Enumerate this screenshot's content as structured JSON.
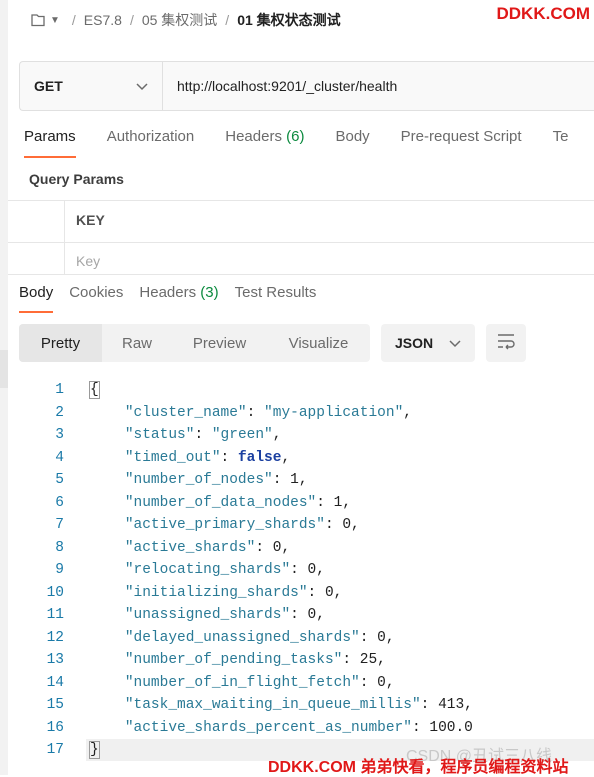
{
  "breadcrumb": {
    "items": [
      "ES7.8",
      "05 集权测试"
    ],
    "current": "01 集权状态测试",
    "separator": "/"
  },
  "watermark_top": "DDKK.COM",
  "request": {
    "method": "GET",
    "url": "http://localhost:9201/_cluster/health"
  },
  "request_tabs": [
    {
      "label": "Params",
      "count": ""
    },
    {
      "label": "Authorization",
      "count": ""
    },
    {
      "label": "Headers",
      "count": "(6)"
    },
    {
      "label": "Body",
      "count": ""
    },
    {
      "label": "Pre-request Script",
      "count": ""
    },
    {
      "label": "Te",
      "count": ""
    }
  ],
  "query_params": {
    "title": "Query Params",
    "key_header": "KEY",
    "key_placeholder": "Key"
  },
  "response_tabs": [
    {
      "label": "Body",
      "count": ""
    },
    {
      "label": "Cookies",
      "count": ""
    },
    {
      "label": "Headers",
      "count": "(3)"
    },
    {
      "label": "Test Results",
      "count": ""
    }
  ],
  "view_modes": [
    "Pretty",
    "Raw",
    "Preview",
    "Visualize"
  ],
  "format": "JSON",
  "code_lines": [
    {
      "n": "1",
      "t": "{"
    },
    {
      "n": "2",
      "t": "    \"cluster_name\": \"my-application\","
    },
    {
      "n": "3",
      "t": "    \"status\": \"green\","
    },
    {
      "n": "4",
      "t": "    \"timed_out\": false,"
    },
    {
      "n": "5",
      "t": "    \"number_of_nodes\": 1,"
    },
    {
      "n": "6",
      "t": "    \"number_of_data_nodes\": 1,"
    },
    {
      "n": "7",
      "t": "    \"active_primary_shards\": 0,"
    },
    {
      "n": "8",
      "t": "    \"active_shards\": 0,"
    },
    {
      "n": "9",
      "t": "    \"relocating_shards\": 0,"
    },
    {
      "n": "10",
      "t": "    \"initializing_shards\": 0,"
    },
    {
      "n": "11",
      "t": "    \"unassigned_shards\": 0,"
    },
    {
      "n": "12",
      "t": "    \"delayed_unassigned_shards\": 0,"
    },
    {
      "n": "13",
      "t": "    \"number_of_pending_tasks\": 25,"
    },
    {
      "n": "14",
      "t": "    \"number_of_in_flight_fetch\": 0,"
    },
    {
      "n": "15",
      "t": "    \"task_max_waiting_in_queue_millis\": 413,"
    },
    {
      "n": "16",
      "t": "    \"active_shards_percent_as_number\": 100.0"
    },
    {
      "n": "17",
      "t": "}"
    }
  ],
  "watermark_bottom": "DDKK.COM 弟弟快看，程序员编程资料站",
  "watermark_csdn": "CSDN @丑试三八线",
  "colors": {
    "accent": "#ff6c37",
    "green": "#0b8a3e",
    "watermark": "#e01818"
  }
}
